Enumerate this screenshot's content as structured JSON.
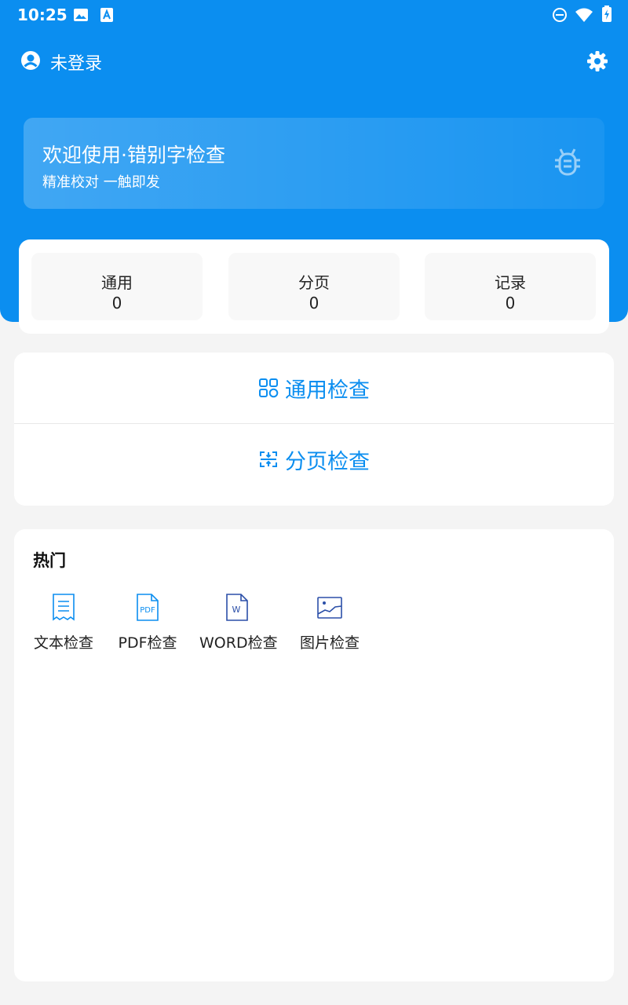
{
  "status_bar": {
    "time": "10:25"
  },
  "header": {
    "login_status": "未登录"
  },
  "banner": {
    "title": "欢迎使用·错别字检查",
    "subtitle": "精准校对 一触即发"
  },
  "stats": [
    {
      "label": "通用",
      "value": "0"
    },
    {
      "label": "分页",
      "value": "0"
    },
    {
      "label": "记录",
      "value": "0"
    }
  ],
  "actions": {
    "general_check": "通用检查",
    "paged_check": "分页检查"
  },
  "hot": {
    "title": "热门",
    "items": [
      {
        "label": "文本检查",
        "icon": "text-doc-icon"
      },
      {
        "label": "PDF检查",
        "icon": "pdf-icon"
      },
      {
        "label": "WORD检查",
        "icon": "word-icon"
      },
      {
        "label": "图片检查",
        "icon": "image-icon"
      }
    ]
  },
  "colors": {
    "primary": "#0b8ef0",
    "background": "#f4f4f4"
  }
}
